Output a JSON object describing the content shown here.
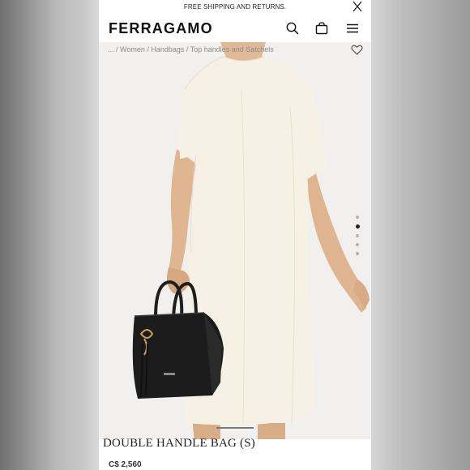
{
  "promo": {
    "text": "FREE SHIPPING AND RETURNS."
  },
  "header": {
    "logo": "FERRAGAMO"
  },
  "breadcrumb": {
    "text": "... / Women / Handbags / Top handles and Satchels"
  },
  "gallery": {
    "slide_count": 5,
    "active_slide": 2
  },
  "product": {
    "name": "DOUBLE HANDLE BAG (S)",
    "price": "C$ 2,560"
  },
  "icons": {
    "promo_close": "close-icon",
    "search": "search-icon",
    "bag": "shopping-bag-icon",
    "menu": "hamburger-menu-icon",
    "wishlist": "heart-icon"
  },
  "colors": {
    "dress": "#f6f1e4",
    "bag": "#1c1c1c",
    "hardware": "#c9a25a"
  }
}
